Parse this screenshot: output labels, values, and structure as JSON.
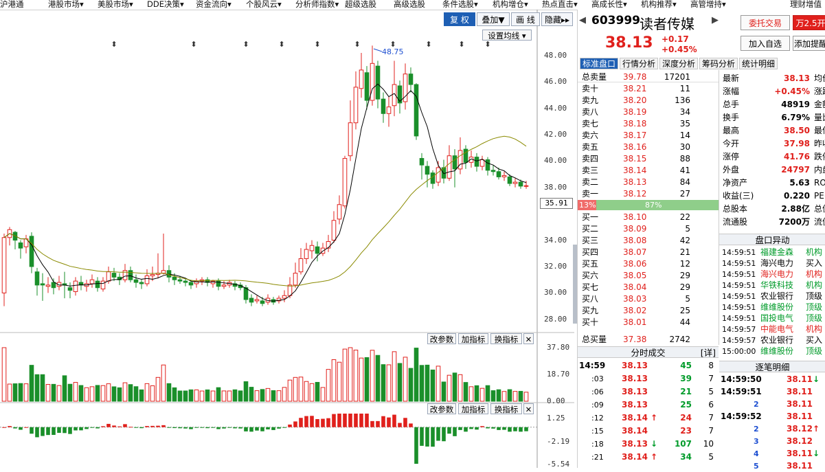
{
  "menu": [
    "沪港通",
    "港股市场",
    "美股市场",
    "DDE决策",
    "资金流向",
    "个股风云",
    "分析师指数",
    "超级选股",
    "高级选股",
    "条件选股",
    "机构增仓",
    "热点直击",
    "高成长性",
    "机构推荐",
    "高管增持",
    "理财增值"
  ],
  "chart_toolbar": {
    "fuquan": "复 权",
    "overlay": "叠加▼",
    "draw": "画 线",
    "hide": "隐藏▸▸",
    "ma_settings": "设置均线 ▾"
  },
  "main_axis": [
    "48.00",
    "46.00",
    "44.00",
    "42.00",
    "40.00",
    "38.00",
    "35.91",
    "34.00",
    "32.00",
    "30.00",
    "28.00"
  ],
  "high_label": "48.75",
  "vol_axis": [
    "37.80",
    "18.70",
    "0.00"
  ],
  "macd_axis": [
    "1.25",
    "-2.19",
    "-5.54"
  ],
  "indicator_buttons": {
    "param": "改参数",
    "add": "加指标",
    "switch": "换指标",
    "close": "✕"
  },
  "stock": {
    "code": "603999",
    "name": "读者传媒",
    "price": "38.13",
    "change": "+0.17",
    "pct": "+0.45%"
  },
  "buttons": {
    "entrust": "委托交易",
    "wan": "万2.5开",
    "addwatch": "加入自选",
    "addnote": "添加提醒"
  },
  "tabs": [
    "标准盘口",
    "行情分析",
    "深度分析",
    "筹码分析",
    "统计明细"
  ],
  "book": {
    "total_sell": {
      "label": "总卖量",
      "price": "39.78",
      "vol": "17201"
    },
    "asks": [
      {
        "label": "卖十",
        "price": "38.21",
        "vol": "11"
      },
      {
        "label": "卖九",
        "price": "38.20",
        "vol": "136"
      },
      {
        "label": "卖八",
        "price": "38.19",
        "vol": "34"
      },
      {
        "label": "卖七",
        "price": "38.18",
        "vol": "35"
      },
      {
        "label": "卖六",
        "price": "38.17",
        "vol": "14"
      },
      {
        "label": "卖五",
        "price": "38.16",
        "vol": "30"
      },
      {
        "label": "卖四",
        "price": "38.15",
        "vol": "88"
      },
      {
        "label": "卖三",
        "price": "38.14",
        "vol": "41"
      },
      {
        "label": "卖二",
        "price": "38.13",
        "vol": "84"
      },
      {
        "label": "卖一",
        "price": "38.12",
        "vol": "27"
      }
    ],
    "ratio": {
      "left": "13%",
      "right": "87%",
      "left_frac": 0.13
    },
    "bids": [
      {
        "label": "买一",
        "price": "38.10",
        "vol": "22"
      },
      {
        "label": "买二",
        "price": "38.09",
        "vol": "5"
      },
      {
        "label": "买三",
        "price": "38.08",
        "vol": "42"
      },
      {
        "label": "买四",
        "price": "38.07",
        "vol": "21"
      },
      {
        "label": "买五",
        "price": "38.06",
        "vol": "12"
      },
      {
        "label": "买六",
        "price": "38.05",
        "vol": "29"
      },
      {
        "label": "买七",
        "price": "38.04",
        "vol": "29"
      },
      {
        "label": "买八",
        "price": "38.03",
        "vol": "5"
      },
      {
        "label": "买九",
        "price": "38.02",
        "vol": "25"
      },
      {
        "label": "买十",
        "price": "38.01",
        "vol": "44"
      }
    ],
    "total_buy": {
      "label": "总买量",
      "price": "37.38",
      "vol": "2742"
    }
  },
  "stats": [
    {
      "l1": "最新",
      "v1": "38.13",
      "c1": "red",
      "l2": "均价"
    },
    {
      "l1": "涨幅",
      "v1": "+0.45%",
      "c1": "red",
      "l2": "涨跌"
    },
    {
      "l1": "总手",
      "v1": "48919",
      "c1": "blk",
      "l2": "金额"
    },
    {
      "l1": "换手",
      "v1": "6.79%",
      "c1": "blk",
      "l2": "量比"
    },
    {
      "l1": "最高",
      "v1": "38.50",
      "c1": "red",
      "l2": "最低"
    },
    {
      "l1": "今开",
      "v1": "37.98",
      "c1": "red",
      "l2": "昨收"
    },
    {
      "l1": "涨停",
      "v1": "41.76",
      "c1": "red",
      "l2": "跌停"
    },
    {
      "l1": "外盘",
      "v1": "24797",
      "c1": "red",
      "l2": "内盘"
    },
    {
      "l1": "净资产",
      "v1": "5.63",
      "c1": "blk",
      "l2": "ROE"
    },
    {
      "l1": "收益(三)",
      "v1": "0.220",
      "c1": "blk",
      "l2": "PE(动)"
    },
    {
      "l1": "总股本",
      "v1": "2.88亿",
      "c1": "blk",
      "l2": "总值"
    },
    {
      "l1": "流通股",
      "v1": "7200万",
      "c1": "blk",
      "l2": "流值"
    }
  ],
  "anomaly": {
    "title": "盘口异动",
    "rows": [
      {
        "t": "14:59:51",
        "n": "福建金森",
        "c": "green",
        "x": "机构"
      },
      {
        "t": "14:59:51",
        "n": "海兴电力",
        "c": "blk",
        "x": "买入"
      },
      {
        "t": "14:59:51",
        "n": "海兴电力",
        "c": "red",
        "x": "机构"
      },
      {
        "t": "14:59:51",
        "n": "华铁科技",
        "c": "green",
        "x": "机构"
      },
      {
        "t": "14:59:51",
        "n": "农业银行",
        "c": "blk",
        "x": "顶级"
      },
      {
        "t": "14:59:51",
        "n": "维维股份",
        "c": "green",
        "x": "顶级"
      },
      {
        "t": "14:59:51",
        "n": "国投电气",
        "c": "green",
        "x": "顶级"
      },
      {
        "t": "14:59:57",
        "n": "中能电气",
        "c": "red",
        "x": "机构"
      },
      {
        "t": "14:59:57",
        "n": "农业银行",
        "c": "blk",
        "x": "买入"
      },
      {
        "t": "15:00:00",
        "n": "维维股份",
        "c": "green",
        "x": "顶级"
      }
    ]
  },
  "fenshi": {
    "title": "分时成交",
    "detail": "[详]",
    "rows": [
      {
        "t": "14:59",
        "p": "38.13",
        "a": "",
        "v": "45",
        "n": "8",
        "vc": "green"
      },
      {
        "t": ":03",
        "p": "38.13",
        "a": "",
        "v": "39",
        "n": "7",
        "vc": "green"
      },
      {
        "t": ":06",
        "p": "38.13",
        "a": "",
        "v": "21",
        "n": "5",
        "vc": "green"
      },
      {
        "t": ":09",
        "p": "38.13",
        "a": "",
        "v": "25",
        "n": "6",
        "vc": "green"
      },
      {
        "t": ":12",
        "p": "38.14",
        "a": "↑",
        "v": "24",
        "n": "7",
        "vc": "red"
      },
      {
        "t": ":15",
        "p": "38.14",
        "a": "",
        "v": "23",
        "n": "7",
        "vc": "red"
      },
      {
        "t": ":18",
        "p": "38.13",
        "a": "↓",
        "v": "107",
        "n": "10",
        "vc": "green"
      },
      {
        "t": ":21",
        "p": "38.14",
        "a": "↑",
        "v": "34",
        "n": "5",
        "vc": "green"
      }
    ]
  },
  "zhubi": {
    "title": "逐笔明细",
    "rows": [
      {
        "t": "14:59:50",
        "p": "38.11",
        "a": "↓",
        "ac": "green"
      },
      {
        "t": "14:59:51",
        "p": "38.11",
        "a": "",
        "ac": ""
      },
      {
        "t": "2",
        "p": "38.11",
        "a": "",
        "ac": ""
      },
      {
        "t": "14:59:52",
        "p": "38.11",
        "a": "",
        "ac": ""
      },
      {
        "t": "2",
        "p": "38.12",
        "a": "↑",
        "ac": "red"
      },
      {
        "t": "3",
        "p": "38.12",
        "a": "",
        "ac": ""
      },
      {
        "t": "4",
        "p": "38.11",
        "a": "↓",
        "ac": "green"
      },
      {
        "t": "5",
        "p": "38.11",
        "a": "",
        "ac": ""
      }
    ]
  },
  "chart_data": {
    "type": "candlestick",
    "price_ylim": [
      27.0,
      49.5
    ],
    "candles": [
      [
        30.0,
        34.2,
        34.5,
        29.0
      ],
      [
        34.2,
        34.8,
        35.0,
        33.6
      ],
      [
        34.6,
        34.0,
        34.7,
        33.3
      ],
      [
        33.8,
        33.4,
        34.0,
        32.6
      ],
      [
        33.5,
        34.1,
        34.4,
        33.0
      ],
      [
        34.3,
        32.0,
        34.6,
        31.5
      ],
      [
        31.6,
        30.6,
        31.9,
        29.8
      ],
      [
        30.7,
        30.6,
        31.5,
        29.4
      ],
      [
        30.5,
        30.6,
        31.2,
        30.0
      ],
      [
        30.8,
        30.4,
        31.1,
        29.9
      ],
      [
        30.5,
        30.8,
        31.3,
        30.2
      ],
      [
        30.7,
        30.6,
        31.6,
        29.6
      ],
      [
        30.4,
        30.2,
        30.8,
        29.6
      ],
      [
        30.1,
        30.9,
        31.2,
        29.8
      ],
      [
        30.8,
        30.6,
        31.3,
        30.2
      ],
      [
        30.5,
        30.7,
        31.0,
        30.1
      ],
      [
        30.7,
        31.0,
        31.4,
        30.4
      ],
      [
        30.9,
        30.4,
        31.2,
        30.1
      ],
      [
        30.3,
        30.9,
        31.2,
        30.1
      ],
      [
        30.9,
        31.6,
        32.0,
        30.7
      ],
      [
        31.5,
        31.2,
        31.9,
        30.9
      ],
      [
        31.2,
        31.0,
        31.5,
        30.6
      ],
      [
        31.0,
        31.7,
        32.2,
        30.8
      ],
      [
        31.7,
        31.0,
        32.0,
        30.8
      ],
      [
        31.0,
        30.8,
        31.4,
        30.4
      ],
      [
        30.8,
        30.7,
        31.0,
        30.3
      ],
      [
        30.7,
        31.3,
        31.8,
        30.5
      ],
      [
        31.3,
        31.4,
        32.0,
        30.9
      ],
      [
        31.4,
        31.5,
        33.0,
        31.1
      ],
      [
        31.5,
        31.7,
        34.5,
        31.4
      ],
      [
        31.7,
        31.2,
        32.1,
        30.8
      ],
      [
        31.2,
        31.0,
        31.5,
        30.6
      ],
      [
        31.0,
        30.9,
        31.3,
        30.7
      ],
      [
        30.9,
        30.8,
        31.1,
        30.5
      ],
      [
        30.8,
        30.6,
        31.0,
        30.3
      ],
      [
        30.7,
        30.9,
        31.1,
        30.4
      ],
      [
        30.9,
        31.0,
        31.2,
        30.6
      ],
      [
        31.0,
        30.8,
        31.2,
        30.5
      ],
      [
        30.7,
        30.9,
        31.0,
        30.4
      ],
      [
        30.9,
        30.5,
        31.1,
        30.2
      ],
      [
        30.5,
        30.6,
        30.9,
        30.3
      ],
      [
        30.6,
        30.8,
        31.0,
        30.4
      ],
      [
        30.7,
        30.5,
        30.9,
        30.2
      ],
      [
        30.6,
        30.4,
        30.8,
        30.2
      ],
      [
        30.4,
        29.5,
        30.6,
        29.2
      ],
      [
        29.6,
        29.3,
        29.9,
        29.0
      ],
      [
        29.4,
        29.5,
        29.8,
        29.2
      ],
      [
        29.4,
        29.2,
        29.7,
        29.0
      ],
      [
        29.3,
        29.6,
        29.9,
        29.1
      ],
      [
        29.5,
        29.3,
        29.7,
        29.1
      ],
      [
        29.4,
        29.6,
        29.8,
        29.2
      ],
      [
        29.6,
        29.8,
        30.2,
        29.3
      ],
      [
        29.8,
        30.6,
        31.2,
        29.6
      ],
      [
        30.6,
        31.5,
        32.3,
        30.4
      ],
      [
        31.6,
        32.6,
        33.4,
        31.4
      ],
      [
        32.6,
        33.3,
        33.8,
        32.2
      ],
      [
        33.2,
        33.6,
        34.0,
        32.6
      ],
      [
        33.5,
        33.0,
        33.9,
        32.4
      ],
      [
        33.0,
        33.4,
        33.8,
        32.8
      ],
      [
        33.4,
        33.9,
        34.4,
        33.1
      ],
      [
        34.0,
        35.5,
        36.2,
        33.8
      ],
      [
        35.6,
        36.7,
        37.4,
        35.2
      ],
      [
        36.6,
        40.2,
        40.4,
        36.4
      ],
      [
        40.4,
        42.9,
        44.6,
        40.0
      ],
      [
        42.9,
        45.6,
        46.8,
        42.4
      ],
      [
        45.5,
        46.9,
        48.2,
        44.8
      ],
      [
        46.7,
        44.6,
        47.2,
        43.9
      ],
      [
        44.6,
        47.4,
        48.75,
        44.2
      ],
      [
        47.2,
        44.7,
        47.6,
        44.0
      ],
      [
        44.7,
        43.6,
        45.2,
        42.9
      ],
      [
        43.6,
        44.1,
        44.9,
        42.6
      ],
      [
        44.2,
        45.8,
        47.6,
        43.4
      ],
      [
        45.7,
        44.4,
        46.1,
        43.6
      ],
      [
        44.5,
        46.6,
        47.4,
        43.9
      ],
      [
        46.6,
        45.8,
        47.1,
        45.2
      ],
      [
        45.8,
        41.9,
        45.9,
        41.6
      ],
      [
        40.2,
        39.7,
        40.6,
        38.6
      ],
      [
        39.6,
        39.0,
        40.0,
        38.0
      ],
      [
        39.1,
        38.3,
        39.3,
        37.9
      ],
      [
        38.4,
        39.5,
        40.0,
        38.1
      ],
      [
        39.5,
        38.7,
        40.1,
        38.3
      ],
      [
        38.7,
        40.4,
        41.2,
        38.5
      ],
      [
        40.4,
        39.4,
        40.9,
        38.0
      ],
      [
        39.4,
        40.8,
        41.8,
        39.0
      ],
      [
        40.9,
        39.9,
        41.2,
        39.4
      ],
      [
        39.9,
        40.3,
        40.8,
        39.5
      ],
      [
        40.3,
        39.6,
        40.6,
        39.2
      ],
      [
        39.6,
        40.1,
        40.4,
        39.3
      ],
      [
        40.1,
        39.3,
        40.3,
        38.9
      ],
      [
        39.3,
        39.2,
        39.7,
        38.9
      ],
      [
        39.2,
        38.8,
        39.5,
        38.6
      ],
      [
        38.8,
        38.9,
        39.2,
        38.5
      ],
      [
        38.8,
        38.3,
        39.0,
        38.1
      ],
      [
        38.3,
        38.4,
        38.7,
        38.0
      ],
      [
        38.4,
        38.1,
        38.6,
        37.9
      ],
      [
        38.1,
        38.13,
        38.5,
        37.9
      ]
    ],
    "volume_ylim": [
      0,
      42
    ],
    "macd_ylim": [
      -6.0,
      2.0
    ]
  }
}
